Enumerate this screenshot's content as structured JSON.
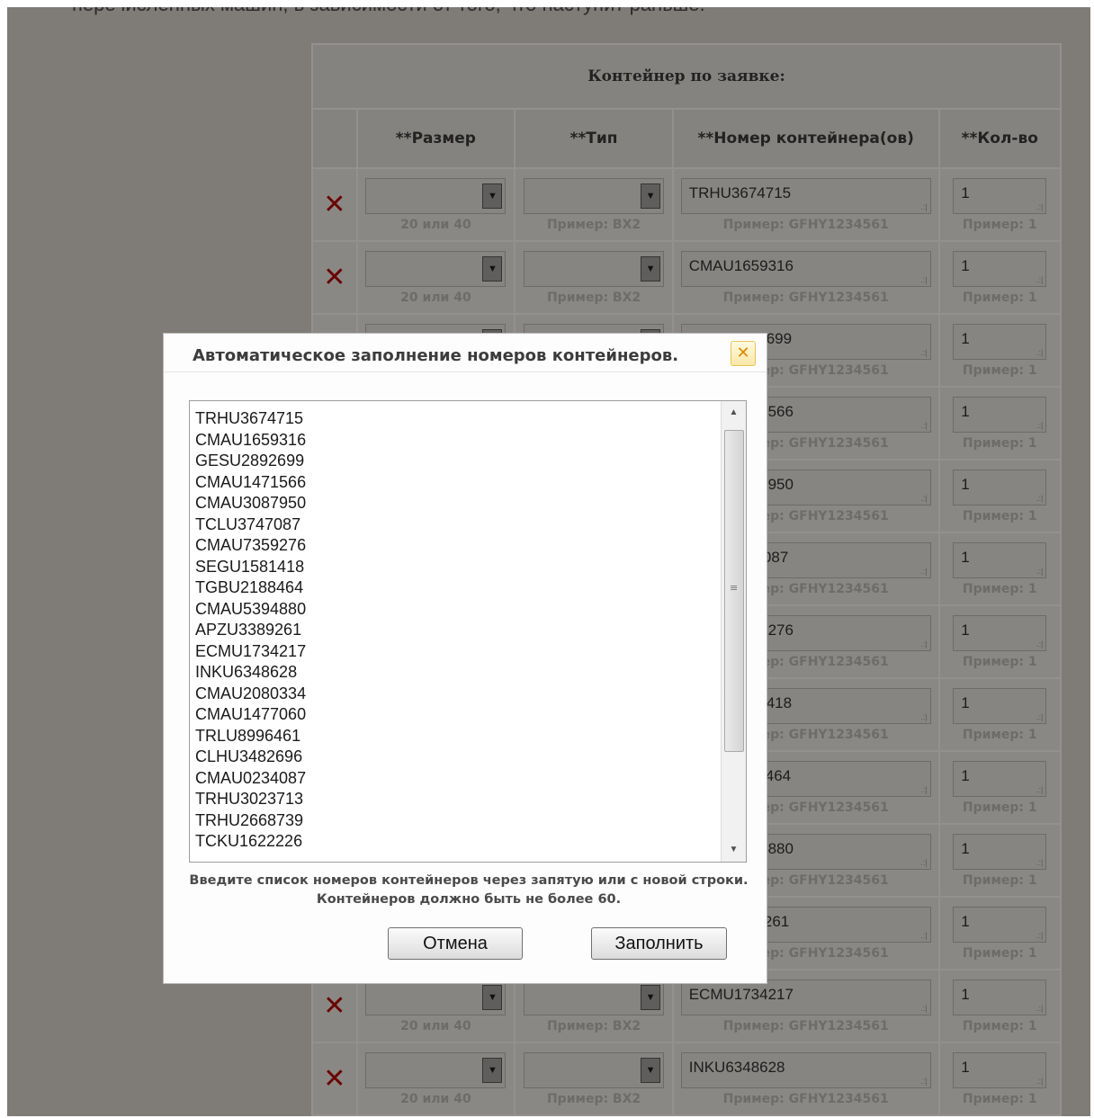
{
  "page": {
    "intro_text": "перечисленных машин, в зависимости от того, что наступит раньше."
  },
  "table": {
    "caption": "Контейнер по заявке:",
    "headers": {
      "size": "**Размер",
      "type": "**Тип",
      "number": "**Номер контейнера(ов)",
      "qty": "**Кол-во"
    },
    "hints": {
      "size": "20 или 40",
      "type": "Пример: BX2",
      "number": "Пример: GFHY1234561",
      "qty": "Пример: 1"
    },
    "rows": [
      {
        "number": "TRHU3674715",
        "qty": "1"
      },
      {
        "number": "CMAU1659316",
        "qty": "1"
      },
      {
        "number": "GESU2892699",
        "qty": "1"
      },
      {
        "number": "CMAU1471566",
        "qty": "1"
      },
      {
        "number": "CMAU3087950",
        "qty": "1"
      },
      {
        "number": "TCLU3747087",
        "qty": "1"
      },
      {
        "number": "CMAU7359276",
        "qty": "1"
      },
      {
        "number": "SEGU1581418",
        "qty": "1"
      },
      {
        "number": "TGBU2188464",
        "qty": "1"
      },
      {
        "number": "CMAU5394880",
        "qty": "1"
      },
      {
        "number": "APZU3389261",
        "qty": "1"
      },
      {
        "number": "ECMU1734217",
        "qty": "1"
      },
      {
        "number": "INKU6348628",
        "qty": "1"
      }
    ],
    "delete_glyph": "✕"
  },
  "modal": {
    "title": "Автоматическое заполнение номеров контейнеров.",
    "close_glyph": "✕",
    "list": [
      "TRHU3674715",
      "CMAU1659316",
      "GESU2892699",
      "CMAU1471566",
      "CMAU3087950",
      "TCLU3747087",
      "CMAU7359276",
      "SEGU1581418",
      "TGBU2188464",
      "CMAU5394880",
      "APZU3389261",
      "ECMU1734217",
      "INKU6348628",
      "CMAU2080334",
      "CMAU1477060",
      "TRLU8996461",
      "CLHU3482696",
      "CMAU0234087",
      "TRHU3023713",
      "TRHU2668739",
      "TCKU1622226"
    ],
    "note": "Введите список номеров контейнеров через запятую или с новой строки. Контейнеров должно быть не более 60.",
    "cancel_label": "Отмена",
    "fill_label": "Заполнить"
  },
  "icons": {
    "delete": "delete-x-icon",
    "dropdown": "chevron-down-icon",
    "resize": "resize-grip-icon",
    "close": "close-icon"
  }
}
